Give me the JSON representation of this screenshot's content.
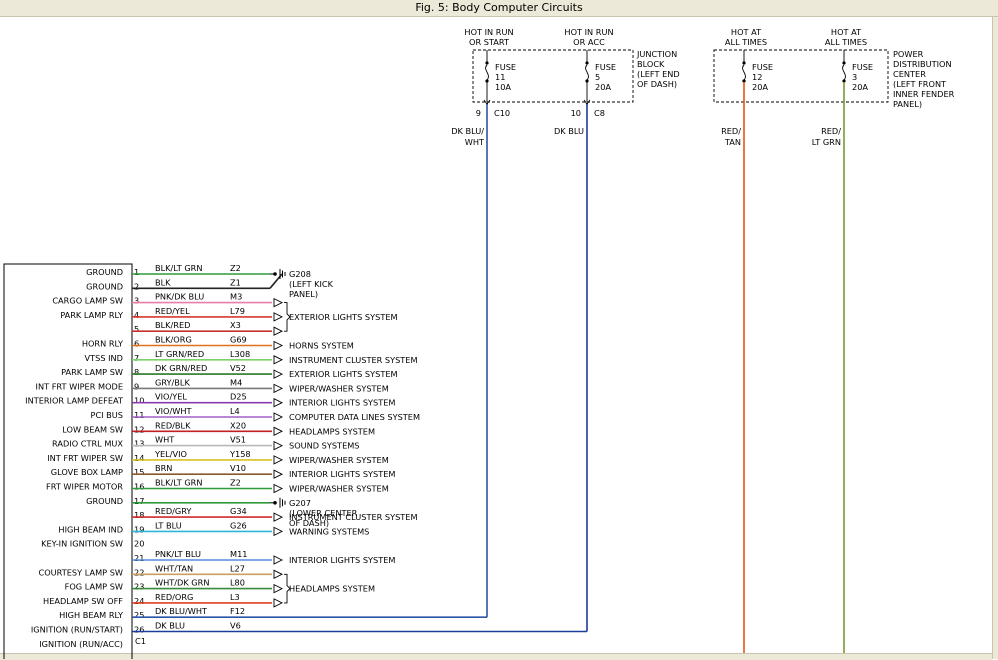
{
  "window": {
    "title": "Fig. 5: Body Computer Circuits"
  },
  "junction_block": {
    "label": [
      "JUNCTION",
      "BLOCK",
      "(LEFT END",
      "OF DASH)"
    ],
    "fuses": [
      {
        "hot": [
          "HOT IN RUN",
          "OR START"
        ],
        "fuse": [
          "FUSE",
          "11",
          "10A"
        ],
        "pin": "9",
        "conn": "C10",
        "wire": [
          "DK BLU/",
          "WHT"
        ],
        "color": "#2a55a8"
      },
      {
        "hot": [
          "HOT IN RUN",
          "OR ACC"
        ],
        "fuse": [
          "FUSE",
          "5",
          "20A"
        ],
        "pin": "10",
        "conn": "C8",
        "wire": [
          "DK BLU"
        ],
        "color": "#1a3c9c"
      }
    ]
  },
  "pdc": {
    "label": [
      "POWER",
      "DISTRIBUTION",
      "CENTER",
      "(LEFT FRONT",
      "INNER FENDER",
      "PANEL)"
    ],
    "fuses": [
      {
        "hot": [
          "HOT AT",
          "ALL TIMES"
        ],
        "fuse": [
          "FUSE",
          "12",
          "20A"
        ],
        "wire": [
          "RED/",
          "TAN"
        ],
        "color": "#e8541a"
      },
      {
        "hot": [
          "HOT AT",
          "ALL TIMES"
        ],
        "fuse": [
          "FUSE",
          "3",
          "20A"
        ],
        "wire": [
          "RED/",
          "LT GRN"
        ],
        "color": "#7a9a2a"
      }
    ]
  },
  "module": {
    "connector": "C1"
  },
  "pins": [
    {
      "label": "GROUND",
      "num": "1",
      "wire": "BLK/LT GRN",
      "ckt": "Z2",
      "color": "#2e9a3a",
      "kind": "ground"
    },
    {
      "label": "GROUND",
      "num": "2",
      "wire": "BLK",
      "ckt": "Z1",
      "color": "#222222",
      "kind": "ground"
    },
    {
      "label": "CARGO LAMP SW",
      "num": "3",
      "wire": "PNK/DK BLU",
      "ckt": "M3",
      "color": "#e87fa8",
      "kind": "arrow"
    },
    {
      "label": "PARK LAMP RLY",
      "num": "4",
      "wire": "RED/YEL",
      "ckt": "L79",
      "color": "#d83a2a",
      "kind": "arrow"
    },
    {
      "label": "",
      "num": "5",
      "wire": "BLK/RED",
      "ckt": "X3",
      "color": "#c83030",
      "kind": "arrow"
    },
    {
      "label": "HORN RLY",
      "num": "6",
      "wire": "BLK/ORG",
      "ckt": "G69",
      "color": "#e0701a",
      "kind": "arrow"
    },
    {
      "label": "VTSS IND",
      "num": "7",
      "wire": "LT GRN/RED",
      "ckt": "L308",
      "color": "#7ad06a",
      "kind": "arrow"
    },
    {
      "label": "PARK LAMP SW",
      "num": "8",
      "wire": "DK GRN/RED",
      "ckt": "V52",
      "color": "#2a7a2a",
      "kind": "arrow"
    },
    {
      "label": "INT FRT WIPER MODE",
      "num": "9",
      "wire": "GRY/BLK",
      "ckt": "M4",
      "color": "#7a7a7a",
      "kind": "arrow"
    },
    {
      "label": "INTERIOR LAMP DEFEAT",
      "num": "10",
      "wire": "VIO/YEL",
      "ckt": "D25",
      "color": "#8a3ab0",
      "kind": "arrow"
    },
    {
      "label": "PCI BUS",
      "num": "11",
      "wire": "VIO/WHT",
      "ckt": "L4",
      "color": "#a060c8",
      "kind": "arrow"
    },
    {
      "label": "LOW BEAM SW",
      "num": "12",
      "wire": "RED/BLK",
      "ckt": "X20",
      "color": "#c02020",
      "kind": "arrow"
    },
    {
      "label": "RADIO CTRL MUX",
      "num": "13",
      "wire": "WHT",
      "ckt": "V51",
      "color": "#b8b8b8",
      "kind": "arrow"
    },
    {
      "label": "INT FRT WIPER SW",
      "num": "14",
      "wire": "YEL/VIO",
      "ckt": "Y158",
      "color": "#d8c020",
      "kind": "arrow"
    },
    {
      "label": "GLOVE BOX LAMP",
      "num": "15",
      "wire": "BRN",
      "ckt": "V10",
      "color": "#8a5a2a",
      "kind": "arrow"
    },
    {
      "label": "FRT WIPER MOTOR",
      "num": "16",
      "wire": "BLK/LT GRN",
      "ckt": "Z2",
      "color": "#2e9a3a",
      "kind": "arrow"
    },
    {
      "label": "GROUND",
      "num": "17",
      "wire": "",
      "ckt": "",
      "color": "#2e9a3a",
      "kind": "ground"
    },
    {
      "label": "",
      "num": "18",
      "wire": "RED/GRY",
      "ckt": "G34",
      "color": "#d02a2a",
      "kind": "arrow"
    },
    {
      "label": "HIGH BEAM IND",
      "num": "19",
      "wire": "LT BLU",
      "ckt": "G26",
      "color": "#2ab8d8",
      "kind": "arrow"
    },
    {
      "label": "KEY-IN IGNITION SW",
      "num": "20",
      "wire": "",
      "ckt": "",
      "color": "",
      "kind": "none"
    },
    {
      "label": "",
      "num": "21",
      "wire": "PNK/LT BLU",
      "ckt": "M11",
      "color": "#5a8ad8",
      "kind": "arrow"
    },
    {
      "label": "COURTESY LAMP SW",
      "num": "22",
      "wire": "WHT/TAN",
      "ckt": "L27",
      "color": "#c8a060",
      "kind": "arrow"
    },
    {
      "label": "FOG LAMP SW",
      "num": "23",
      "wire": "WHT/DK GRN",
      "ckt": "L80",
      "color": "#3a8a3a",
      "kind": "arrow"
    },
    {
      "label": "HEADLAMP SW OFF",
      "num": "24",
      "wire": "RED/ORG",
      "ckt": "L3",
      "color": "#e04020",
      "kind": "arrow"
    },
    {
      "label": "HIGH BEAM RLY",
      "num": "25",
      "wire": "DK BLU/WHT",
      "ckt": "F12",
      "color": "#2a55a8",
      "kind": "ign"
    },
    {
      "label": "IGNITION (RUN/START)",
      "num": "26",
      "wire": "DK BLU",
      "ckt": "V6",
      "color": "#1a3c9c",
      "kind": "ign"
    }
  ],
  "extra_label": "IGNITION (RUN/ACC)",
  "systems": [
    {
      "text": "EXTERIOR LIGHTS SYSTEM",
      "bracket": [
        2,
        4
      ]
    },
    {
      "text": "HORNS SYSTEM",
      "bracket": [
        5,
        5
      ]
    },
    {
      "text": "INSTRUMENT CLUSTER SYSTEM",
      "bracket": [
        6,
        6
      ]
    },
    {
      "text": "EXTERIOR LIGHTS SYSTEM",
      "bracket": [
        7,
        7
      ]
    },
    {
      "text": "WIPER/WASHER SYSTEM",
      "bracket": [
        8,
        8
      ]
    },
    {
      "text": "INTERIOR LIGHTS SYSTEM",
      "bracket": [
        9,
        9
      ]
    },
    {
      "text": "COMPUTER DATA LINES SYSTEM",
      "bracket": [
        10,
        10
      ]
    },
    {
      "text": "HEADLAMPS SYSTEM",
      "bracket": [
        11,
        11
      ]
    },
    {
      "text": "SOUND SYSTEMS",
      "bracket": [
        12,
        12
      ]
    },
    {
      "text": "WIPER/WASHER SYSTEM",
      "bracket": [
        13,
        13
      ]
    },
    {
      "text": "INTERIOR LIGHTS SYSTEM",
      "bracket": [
        14,
        14
      ]
    },
    {
      "text": "WIPER/WASHER SYSTEM",
      "bracket": [
        15,
        15
      ]
    },
    {
      "text": "INSTRUMENT CLUSTER SYSTEM",
      "bracket": [
        17,
        17
      ]
    },
    {
      "text": "WARNING SYSTEMS",
      "bracket": [
        18,
        18
      ]
    },
    {
      "text": "INTERIOR LIGHTS SYSTEM",
      "bracket": [
        20,
        20
      ]
    },
    {
      "text": "HEADLAMPS SYSTEM",
      "bracket": [
        21,
        23
      ]
    }
  ],
  "grounds": [
    {
      "id": "G208",
      "lines": [
        "G208",
        "(LEFT KICK",
        "PANEL)"
      ],
      "pins": [
        0,
        1
      ]
    },
    {
      "id": "G207",
      "lines": [
        "G207",
        "(LOWER CENTER",
        "OF DASH)"
      ],
      "pins": [
        16
      ]
    }
  ]
}
